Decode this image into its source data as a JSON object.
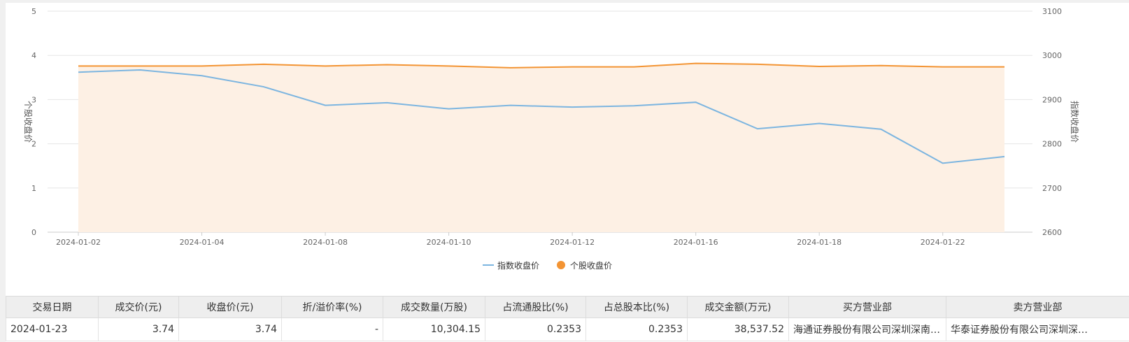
{
  "chart_data": {
    "type": "line",
    "x": [
      "2024-01-02",
      "2024-01-03",
      "2024-01-04",
      "2024-01-05",
      "2024-01-08",
      "2024-01-09",
      "2024-01-10",
      "2024-01-11",
      "2024-01-12",
      "2024-01-15",
      "2024-01-16",
      "2024-01-17",
      "2024-01-18",
      "2024-01-19",
      "2024-01-22",
      "2024-01-23"
    ],
    "x_tick_labels": [
      "2024-01-02",
      "2024-01-04",
      "2024-01-08",
      "2024-01-10",
      "2024-01-12",
      "2024-01-16",
      "2024-01-18",
      "2024-01-22"
    ],
    "y_left": {
      "label": "个股收盘价",
      "ylim": [
        0,
        5
      ],
      "ticks": [
        "0",
        "1",
        "2",
        "3",
        "4",
        "5"
      ]
    },
    "y_right": {
      "label": "指数收盘价",
      "ylim": [
        2600,
        3100
      ],
      "ticks": [
        "2600",
        "2700",
        "2800",
        "2900",
        "3000",
        "3100"
      ]
    },
    "series": [
      {
        "name": "指数收盘价",
        "axis": "right",
        "color": "#7cb5e0",
        "values": [
          2962,
          2967,
          2954,
          2929,
          2887,
          2893,
          2879,
          2887,
          2883,
          2886,
          2894,
          2834,
          2846,
          2833,
          2756,
          2771
        ]
      },
      {
        "name": "个股收盘价",
        "axis": "left",
        "color": "#f39433",
        "area": true,
        "area_color": "#fdf0e4",
        "values": [
          3.76,
          3.76,
          3.76,
          3.8,
          3.76,
          3.79,
          3.76,
          3.72,
          3.74,
          3.74,
          3.82,
          3.8,
          3.75,
          3.77,
          3.74,
          3.74
        ]
      }
    ],
    "legend": {
      "position": "bottom-center",
      "items": [
        "指数收盘价",
        "个股收盘价"
      ]
    },
    "grid": true
  },
  "table": {
    "headers": [
      "交易日期",
      "成交价(元)",
      "收盘价(元)",
      "折/溢价率(%)",
      "成交数量(万股)",
      "占流通股比(%)",
      "占总股本比(%)",
      "成交金额(万元)",
      "买方营业部",
      "卖方营业部"
    ],
    "rows": [
      [
        "2024-01-23",
        "3.74",
        "3.74",
        "-",
        "10,304.15",
        "0.2353",
        "0.2353",
        "38,537.52",
        "海通证券股份有限公司深圳深南…",
        "华泰证券股份有限公司深圳深…"
      ]
    ]
  }
}
